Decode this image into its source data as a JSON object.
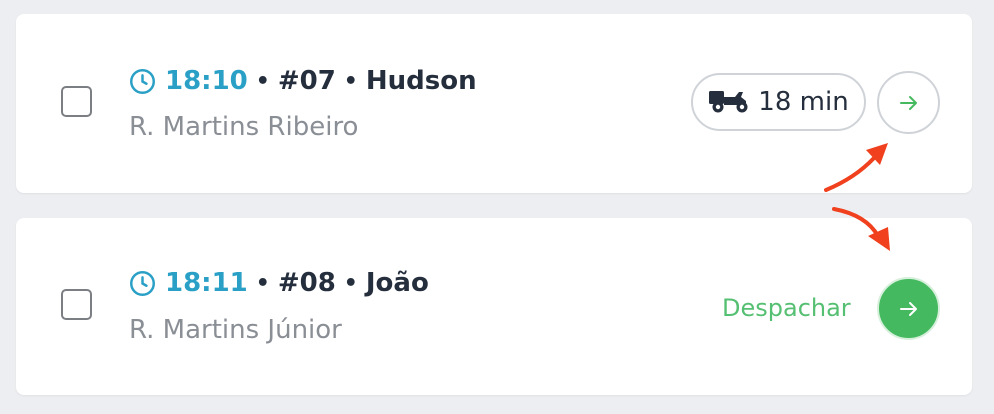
{
  "orders": [
    {
      "time": "18:10",
      "order_number": "#07",
      "customer": "Hudson",
      "address": "R. Martins Ribeiro",
      "eta": "18 min",
      "icons": {
        "clock": "clock-icon",
        "vehicle": "motorcycle-delivery-icon",
        "action": "arrow-right-icon"
      }
    },
    {
      "time": "18:11",
      "order_number": "#08",
      "customer": "João",
      "address": "R. Martins Júnior",
      "action_label": "Despachar",
      "icons": {
        "clock": "clock-icon",
        "action": "arrow-right-icon"
      }
    }
  ],
  "separator": "•",
  "colors": {
    "time": "#2aa0c6",
    "primary_text": "#252e3c",
    "secondary_text": "#8a8e95",
    "dispatch_green": "#45b95f",
    "annotation_arrow": "#f0401e",
    "background": "#eceef1"
  }
}
